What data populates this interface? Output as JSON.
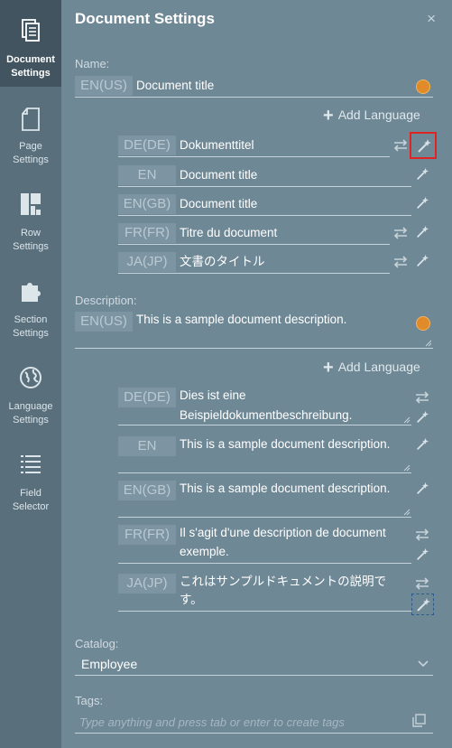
{
  "sidebar": [
    {
      "label1": "Document",
      "label2": "Settings",
      "icon": "document-icon",
      "active": true
    },
    {
      "label1": "Page",
      "label2": "Settings",
      "icon": "page-icon"
    },
    {
      "label1": "Row",
      "label2": "Settings",
      "icon": "row-icon"
    },
    {
      "label1": "Section",
      "label2": "Settings",
      "icon": "puzzle-icon"
    },
    {
      "label1": "Language",
      "label2": "Settings",
      "icon": "globe-icon"
    },
    {
      "label1": "Field",
      "label2": "Selector",
      "icon": "list-icon"
    }
  ],
  "panel": {
    "title": "Document Settings",
    "close": "×",
    "name_label": "Name:",
    "name": {
      "lang": "EN(US)",
      "value": "Document title"
    },
    "add_language": "Add Language",
    "name_translations": [
      {
        "lang": "DE(DE)",
        "value": "Dokumenttitel"
      },
      {
        "lang": "EN",
        "value": "Document title"
      },
      {
        "lang": "EN(GB)",
        "value": "Document title"
      },
      {
        "lang": "FR(FR)",
        "value": "Titre du document"
      },
      {
        "lang": "JA(JP)",
        "value": "文書のタイトル"
      }
    ],
    "description_label": "Description:",
    "description": {
      "lang": "EN(US)",
      "value": "This is a sample document description."
    },
    "description_translations": [
      {
        "lang": "DE(DE)",
        "line1": "Dies ist eine",
        "line2": "Beispieldokumentbeschreibung."
      },
      {
        "lang": "EN",
        "line1": "This is a sample document description.",
        "line2": ""
      },
      {
        "lang": "EN(GB)",
        "line1": "This is a sample document description.",
        "line2": ""
      },
      {
        "lang": "FR(FR)",
        "line1": "Il s'agit d'une description de document",
        "line2": "exemple."
      },
      {
        "lang": "JA(JP)",
        "line1": "これはサンプルドキュメントの説明で",
        "line2": "す。"
      }
    ],
    "catalog_label": "Catalog:",
    "catalog_value": "Employee",
    "tags_label": "Tags:",
    "tags_placeholder": "Type anything and press tab or enter to create tags"
  }
}
